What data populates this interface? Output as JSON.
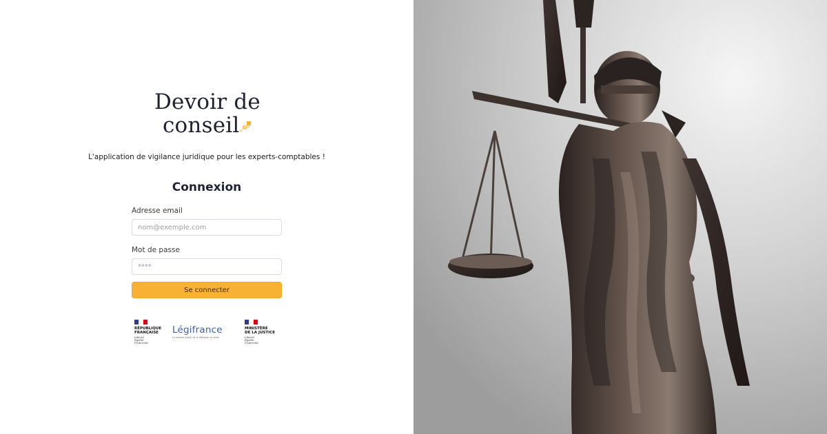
{
  "brand": {
    "logo_line1": "Devoir de",
    "logo_line2": "conseil",
    "accent_color": "#f7b133",
    "text_color": "#1f2233"
  },
  "tagline": "L'application de vigilance juridique pour les experts-comptables !",
  "login": {
    "heading": "Connexion",
    "email_label": "Adresse email",
    "email_placeholder": "nom@exemple.com",
    "password_label": "Mot de passe",
    "password_placeholder": "****",
    "submit_label": "Se connecter"
  },
  "partners": {
    "republique": {
      "title_line1": "RÉPUBLIQUE",
      "title_line2": "FRANÇAISE",
      "motto_line1": "Liberté",
      "motto_line2": "Égalité",
      "motto_line3": "Fraternité"
    },
    "legifrance": {
      "name": "Légifrance",
      "subtitle": "Le service public de la diffusion du droit"
    },
    "ministere": {
      "title_line1": "MINISTÈRE",
      "title_line2": "DE LA JUSTICE",
      "motto_line1": "Liberté",
      "motto_line2": "Égalité",
      "motto_line3": "Fraternité"
    }
  },
  "hero_image": {
    "icon": "lady-justice-statue-image"
  }
}
